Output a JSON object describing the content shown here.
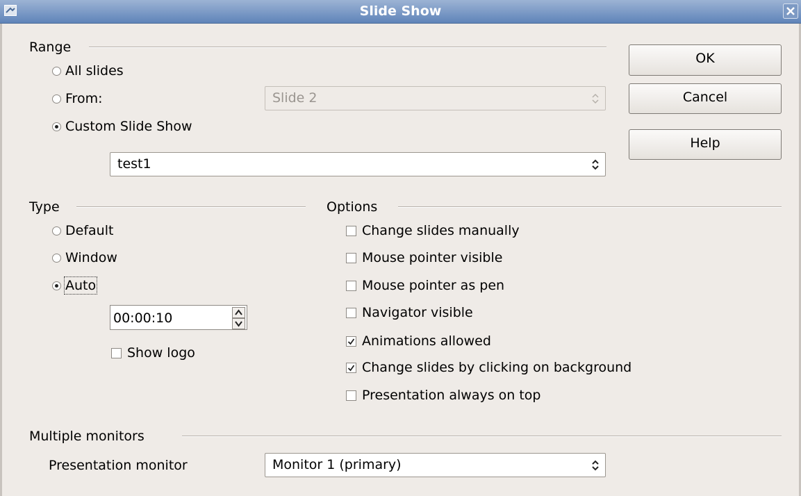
{
  "window": {
    "title": "Slide Show"
  },
  "range": {
    "group_label": "Range",
    "all_slides": "All slides",
    "from": "From:",
    "from_value": "Slide 2",
    "custom": "Custom Slide Show",
    "custom_value": "test1",
    "selected": "custom"
  },
  "buttons": {
    "ok": "OK",
    "cancel": "Cancel",
    "help": "Help"
  },
  "type": {
    "group_label": "Type",
    "default": "Default",
    "window": "Window",
    "auto": "Auto",
    "selected": "auto",
    "duration": "00:00:10",
    "show_logo": "Show logo",
    "show_logo_checked": false
  },
  "options": {
    "group_label": "Options",
    "items": [
      {
        "label": "Change slides manually",
        "checked": false
      },
      {
        "label": "Mouse pointer visible",
        "checked": false
      },
      {
        "label": "Mouse pointer as pen",
        "checked": false
      },
      {
        "label": "Navigator visible",
        "checked": false
      },
      {
        "label": "Animations allowed",
        "checked": true
      },
      {
        "label": "Change slides by clicking on background",
        "checked": true
      },
      {
        "label": "Presentation always on top",
        "checked": false
      }
    ]
  },
  "monitors": {
    "group_label": "Multiple monitors",
    "label": "Presentation monitor",
    "value": "Monitor 1 (primary)"
  },
  "colors": {
    "background": "#efebe7",
    "titlebar": "#5f84b9"
  }
}
